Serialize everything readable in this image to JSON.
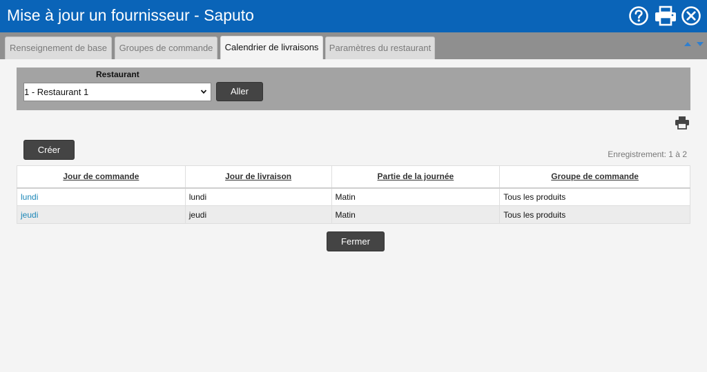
{
  "window": {
    "title": "Mise à jour un fournisseur - Saputo",
    "icons": [
      "help-icon",
      "print-icon",
      "close-icon"
    ],
    "accent_color": "#0a64b8"
  },
  "tabs": [
    {
      "label": "Renseignement de base",
      "active": false
    },
    {
      "label": "Groupes de commande",
      "active": false
    },
    {
      "label": "Calendrier de livraisons",
      "active": true
    },
    {
      "label": "Paramètres du restaurant",
      "active": false
    }
  ],
  "filter": {
    "label": "Restaurant",
    "selected": "1 - Restaurant 1",
    "go_label": "Aller"
  },
  "toolbar": {
    "create_label": "Créer",
    "records": "Enregistrement: 1 à 2"
  },
  "table": {
    "columns": [
      "Jour de commande",
      "Jour de livraison",
      "Partie de la journée",
      "Groupe de commande"
    ],
    "rows": [
      [
        "lundi",
        "lundi",
        "Matin",
        "Tous les produits"
      ],
      [
        "jeudi",
        "jeudi",
        "Matin",
        "Tous les produits"
      ]
    ]
  },
  "footer": {
    "close_label": "Fermer"
  }
}
